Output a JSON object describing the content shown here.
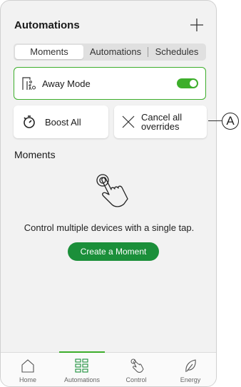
{
  "header": {
    "title": "Automations"
  },
  "tabs": [
    {
      "label": "Moments",
      "active": true
    },
    {
      "label": "Automations",
      "active": false
    },
    {
      "label": "Schedules",
      "active": false
    }
  ],
  "away_mode": {
    "label": "Away Mode",
    "enabled": true
  },
  "actions": {
    "boost_label": "Boost All",
    "cancel_line1": "Cancel all",
    "cancel_line2": "overrides"
  },
  "callout": {
    "label": "A"
  },
  "moments": {
    "section_title": "Moments",
    "description": "Control multiple devices with a single tap.",
    "create_label": "Create a Moment"
  },
  "nav": [
    {
      "label": "Home",
      "icon": "home-icon"
    },
    {
      "label": "Automations",
      "icon": "grid-icon",
      "active": true
    },
    {
      "label": "Control",
      "icon": "hand-icon"
    },
    {
      "label": "Energy",
      "icon": "leaf-icon"
    }
  ],
  "colors": {
    "accent": "#3dae2b",
    "button": "#1b8f3a"
  }
}
